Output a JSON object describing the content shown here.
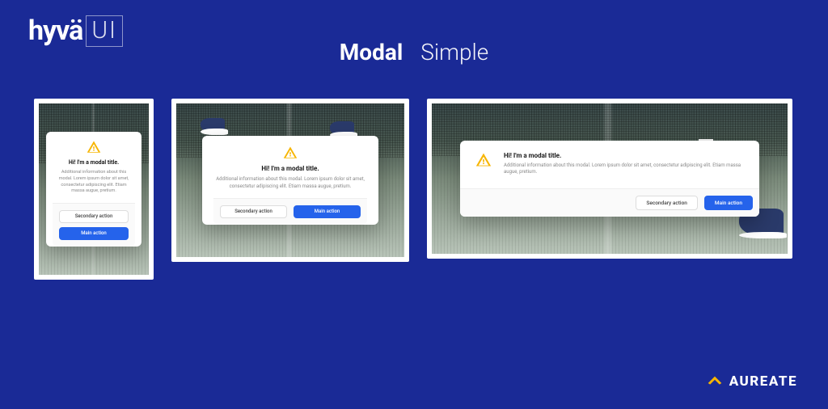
{
  "logo": {
    "text_main": "hyvä",
    "text_suffix": "UI"
  },
  "header": {
    "title_bold": "Modal",
    "title_light": "Simple"
  },
  "modal": {
    "title": "Hi! I'm a modal title.",
    "description_short": "Additional information about this modal. Lorem ipsum dolor sit amet, consectetur adipiscing elit. Etiam massa augue, pretium.",
    "description_long": "Additional information about this modal. Lorem ipsum dolor sit amet, consectetur adipiscing elit. Etiam massa augue, pretium.",
    "secondary_label": "Secondary action",
    "primary_label": "Main action"
  },
  "footer": {
    "brand": "AUREATE"
  },
  "colors": {
    "background": "#1a2a96",
    "primary_button": "#2563eb",
    "warning_icon": "#f7b500"
  }
}
